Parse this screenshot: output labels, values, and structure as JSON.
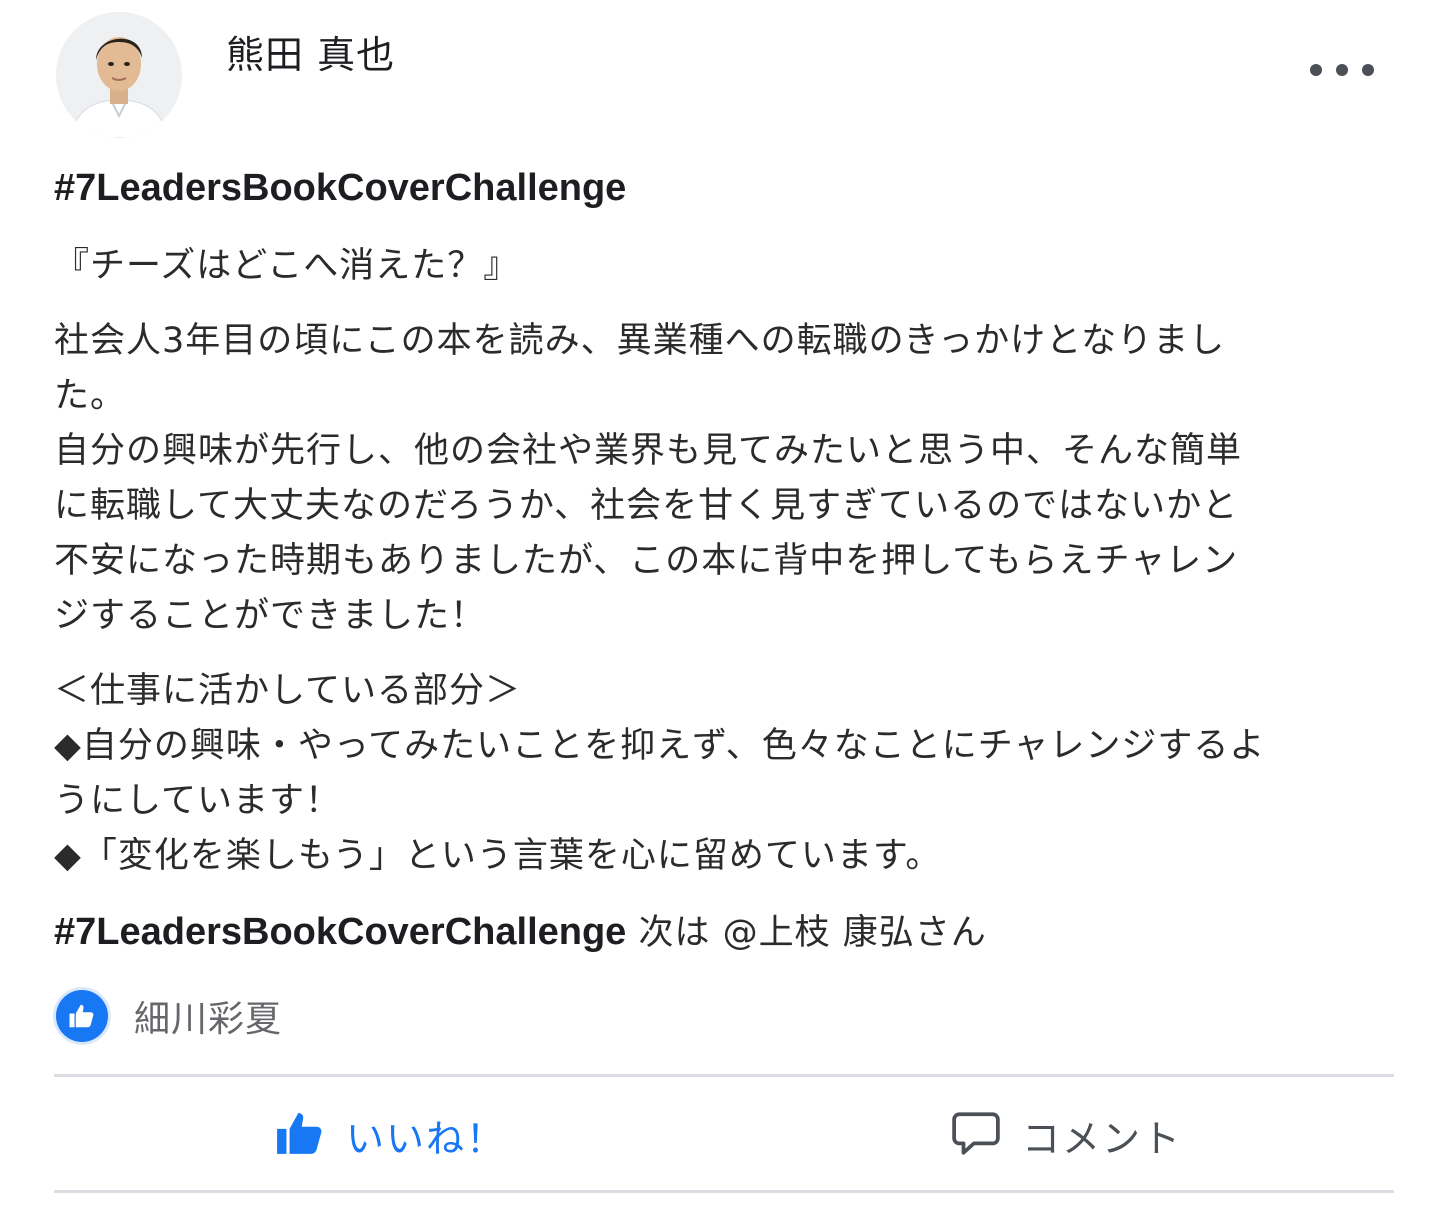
{
  "author": {
    "name": "熊田 真也"
  },
  "post": {
    "hashtag": "#7LeadersBookCoverChallenge",
    "book_title": "『チーズはどこへ消えた？』",
    "para1_line1": "社会人3年目の頃にこの本を読み、異業種への転職のきっかけとなりまし",
    "para1_line2": "た。",
    "para2_line1": "自分の興味が先行し、他の会社や業界も見てみたいと思う中、そんな簡単",
    "para2_line2": "に転職して大丈夫なのだろうか、社会を甘く見すぎているのではないかと",
    "para2_line3": "不安になった時期もありましたが、この本に背中を押してもらえチャレン",
    "para2_line4": "ジすることができました！",
    "section_heading": "＜仕事に活かしている部分＞",
    "bullet1_line1": "◆自分の興味・やってみたいことを抑えず、色々なことにチャレンジするよ",
    "bullet1_line2": "うにしています！",
    "bullet2": "◆「変化を楽しもう」という言葉を心に留めています。",
    "closing_hashtag": "#7LeadersBookCoverChallenge",
    "closing_text": " 次は @上枝 康弘さん"
  },
  "reactions": {
    "reactor": "細川彩夏"
  },
  "actions": {
    "like_label": "いいね！",
    "comment_label": "コメント"
  },
  "colors": {
    "accent": "#1877f2",
    "divider": "#dadde1",
    "muted_text": "#65676b"
  },
  "icons": {
    "menu": "more-dots-icon",
    "reaction": "thumbs-up-icon",
    "like": "thumbs-up-icon",
    "comment": "speech-bubble-icon"
  }
}
